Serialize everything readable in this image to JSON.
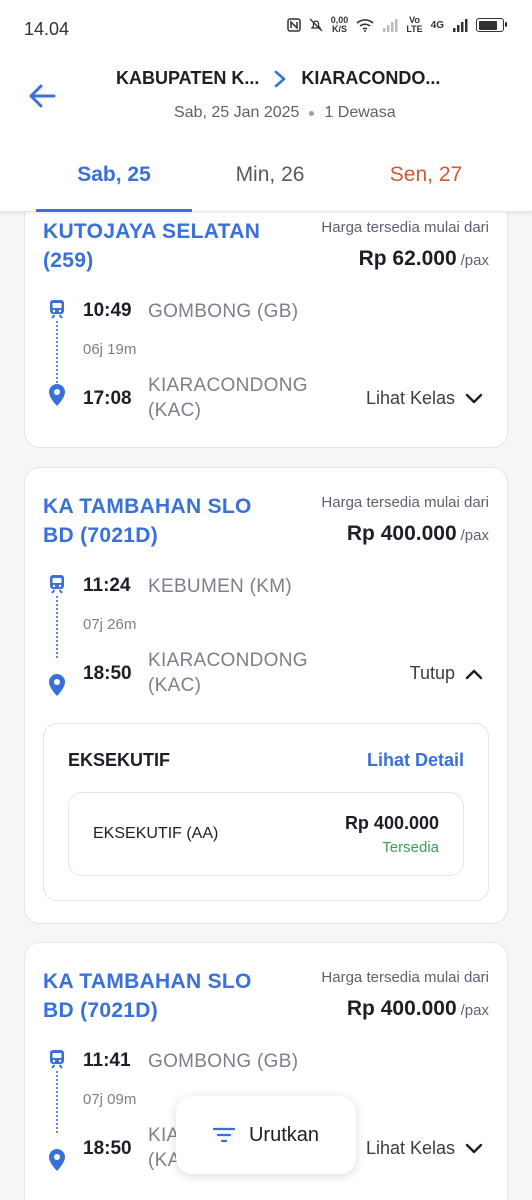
{
  "status_bar": {
    "time": "14.04",
    "speed_value": "0,00",
    "speed_unit": "K/S",
    "volte_top": "Vo",
    "volte_bottom": "LTE",
    "network": "4G",
    "icons": [
      "nfc-icon",
      "mute-icon",
      "wifi-icon",
      "signal-icon",
      "signal-icon",
      "battery-icon"
    ]
  },
  "header": {
    "origin": "KABUPATEN K...",
    "destination": "KIARACONDO...",
    "date": "Sab, 25 Jan 2025",
    "passengers": "1 Dewasa"
  },
  "tabs": [
    {
      "label": "Sab, 25",
      "active": true
    },
    {
      "label": "Min, 26",
      "active": false
    },
    {
      "label": "Sen, 27",
      "active": false,
      "color": "#d45830"
    }
  ],
  "trains": [
    {
      "name": "KUTOJAYA SELATAN (259)",
      "price_caption": "Harga tersedia mulai dari",
      "price": "Rp 62.000",
      "price_unit": "/pax",
      "depart_time": "10:49",
      "depart_station": "GOMBONG (GB)",
      "duration": "06j 19m",
      "arrive_time": "17:08",
      "arrive_station_line1": "KIARACONDONG",
      "arrive_station_line2": "(KAC)",
      "toggle_label": "Lihat Kelas"
    },
    {
      "name": "KA TAMBAHAN SLO BD (7021D)",
      "price_caption": "Harga tersedia mulai dari",
      "price": "Rp 400.000",
      "price_unit": "/pax",
      "depart_time": "11:24",
      "depart_station": "KEBUMEN (KM)",
      "duration": "07j 26m",
      "arrive_time": "18:50",
      "arrive_station_line1": "KIARACONDONG",
      "arrive_station_line2": "(KAC)",
      "toggle_label": "Tutup",
      "class": {
        "title": "EKSEKUTIF",
        "detail_label": "Lihat Detail",
        "sub_name": "EKSEKUTIF (AA)",
        "sub_price": "Rp 400.000",
        "sub_status": "Tersedia"
      }
    },
    {
      "name": "KA TAMBAHAN SLO BD (7021D)",
      "price_caption": "Harga tersedia mulai dari",
      "price": "Rp 400.000",
      "price_unit": "/pax",
      "depart_time": "11:41",
      "depart_station": "GOMBONG (GB)",
      "duration": "07j 09m",
      "arrive_time": "18:50",
      "arrive_station_line1": "KIA",
      "arrive_station_line2": "(KA",
      "toggle_label": "Lihat Kelas"
    }
  ],
  "sort_button": {
    "label": "Urutkan"
  },
  "colors": {
    "accent": "#3a71d9",
    "available": "#3f9e59",
    "holiday": "#d45830"
  }
}
